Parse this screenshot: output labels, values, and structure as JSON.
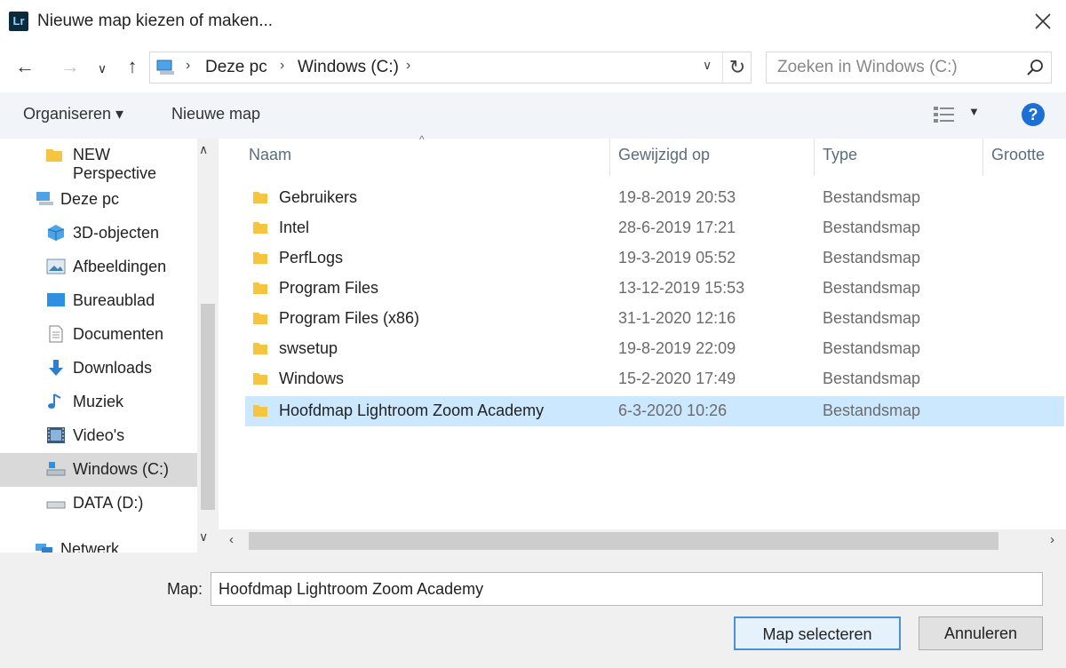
{
  "window": {
    "title": "Nieuwe map kiezen of maken..."
  },
  "nav": {
    "back": "←",
    "forward": "→",
    "recent": "∨",
    "up": "↑"
  },
  "address": {
    "crumbs": [
      "Deze pc",
      "Windows (C:)"
    ]
  },
  "search": {
    "placeholder": "Zoeken in Windows (C:)"
  },
  "toolbar": {
    "organize_label": "Organiseren ▾",
    "new_folder_label": "Nieuwe map",
    "help": "?"
  },
  "sidebar": {
    "items": [
      {
        "label": "NEW Perspective",
        "icon": "folder-icon"
      },
      {
        "label": "Deze pc",
        "icon": "pc-icon"
      },
      {
        "label": "3D-objecten",
        "icon": "3d-objects-icon"
      },
      {
        "label": "Afbeeldingen",
        "icon": "pictures-icon"
      },
      {
        "label": "Bureaublad",
        "icon": "desktop-icon"
      },
      {
        "label": "Documenten",
        "icon": "documents-icon"
      },
      {
        "label": "Downloads",
        "icon": "downloads-icon"
      },
      {
        "label": "Muziek",
        "icon": "music-icon"
      },
      {
        "label": "Video's",
        "icon": "videos-icon"
      },
      {
        "label": "Windows (C:)",
        "icon": "drive-c-icon",
        "selected": true
      },
      {
        "label": "DATA (D:)",
        "icon": "drive-d-icon"
      },
      {
        "label": "Netwerk",
        "icon": "network-icon"
      }
    ]
  },
  "filelist": {
    "columns": [
      "Naam",
      "Gewijzigd op",
      "Type",
      "Grootte"
    ],
    "rows": [
      {
        "name": "Gebruikers",
        "date": "19-8-2019 20:53",
        "type": "Bestandsmap"
      },
      {
        "name": "Intel",
        "date": "28-6-2019 17:21",
        "type": "Bestandsmap"
      },
      {
        "name": "PerfLogs",
        "date": "19-3-2019 05:52",
        "type": "Bestandsmap"
      },
      {
        "name": "Program Files",
        "date": "13-12-2019 15:53",
        "type": "Bestandsmap"
      },
      {
        "name": "Program Files (x86)",
        "date": "31-1-2020 12:16",
        "type": "Bestandsmap"
      },
      {
        "name": "swsetup",
        "date": "19-8-2019 22:09",
        "type": "Bestandsmap"
      },
      {
        "name": "Windows",
        "date": "15-2-2020 17:49",
        "type": "Bestandsmap"
      },
      {
        "name": "Hoofdmap Lightroom Zoom Academy",
        "date": "6-3-2020 10:26",
        "type": "Bestandsmap",
        "selected": true
      }
    ]
  },
  "bottom": {
    "map_label": "Map:",
    "map_value": "Hoofdmap Lightroom Zoom Academy",
    "select_button": "Map selecteren",
    "cancel_button": "Annuleren"
  },
  "colors": {
    "accent": "#1c6fd6",
    "selection": "#cce8ff",
    "folder": "#f5c542"
  }
}
